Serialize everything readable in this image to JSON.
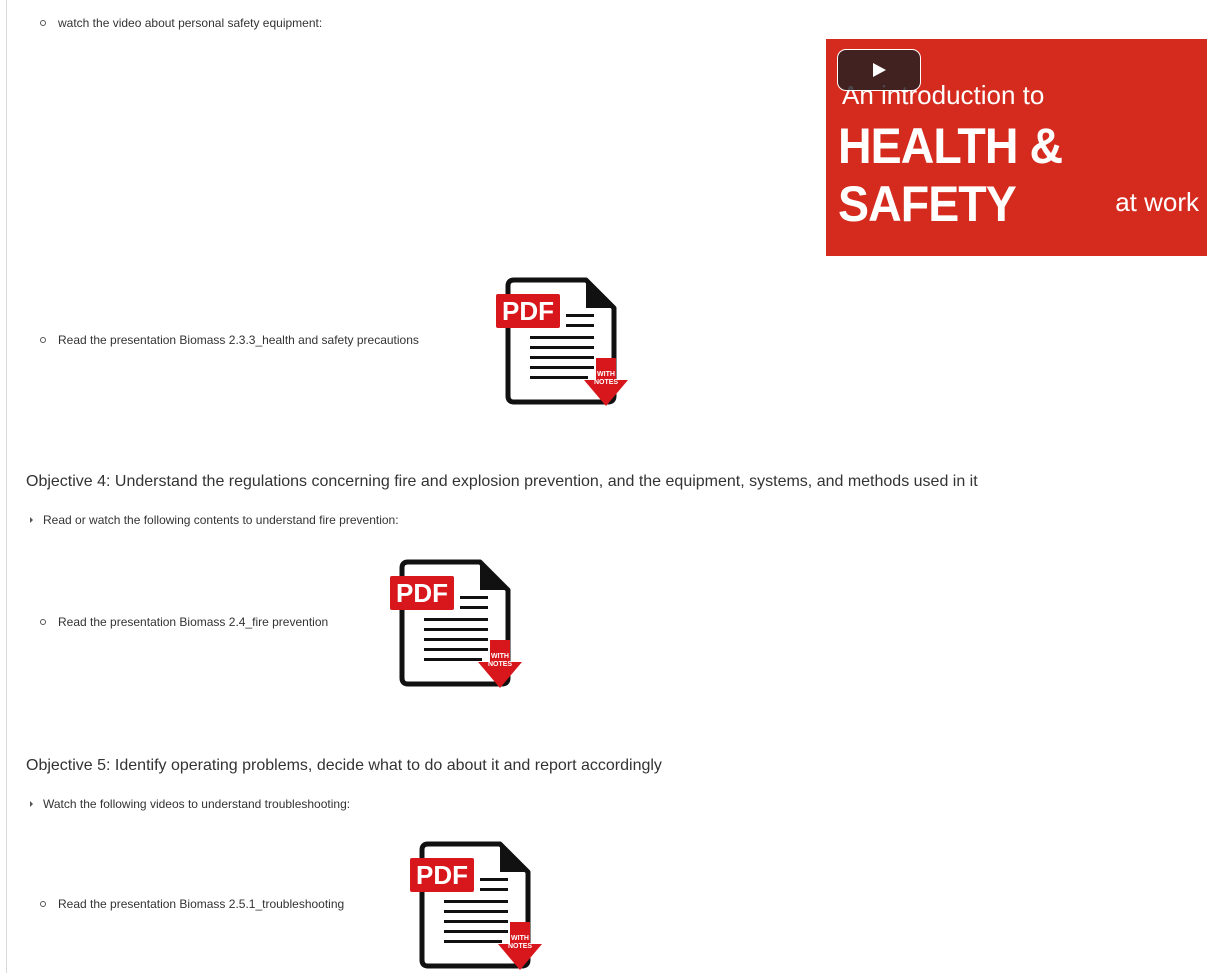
{
  "section3": {
    "video_item": "watch the video about personal safety equipment:",
    "video": {
      "line1": "An introduction to",
      "line2": "HEALTH & SAFETY",
      "line3": "at work",
      "icon": "play-icon"
    },
    "pdf_item": "Read the presentation Biomass 2.3.3_health and safety precautions"
  },
  "objective4": {
    "title": "Objective 4: Understand the regulations concerning fire and explosion prevention, and the equipment, systems, and methods used in it",
    "intro": "Read or watch the following contents to understand fire prevention:",
    "pdf_item": "Read the presentation Biomass 2.4_fire prevention"
  },
  "objective5": {
    "title": "Objective 5: Identify operating problems, decide what to do about it and report accordingly",
    "intro": "Watch the following videos to understand troubleshooting:",
    "pdf_item": "Read the presentation Biomass 2.5.1_troubleshooting"
  },
  "pdf_icon": {
    "badge": "PDF",
    "arrow_label_1": "WITH",
    "arrow_label_2": "NOTES",
    "icon": "pdf-with-notes-icon"
  },
  "colors": {
    "video_bg": "#d52b1e",
    "pdf_red": "#d8171d",
    "text": "#333333"
  }
}
